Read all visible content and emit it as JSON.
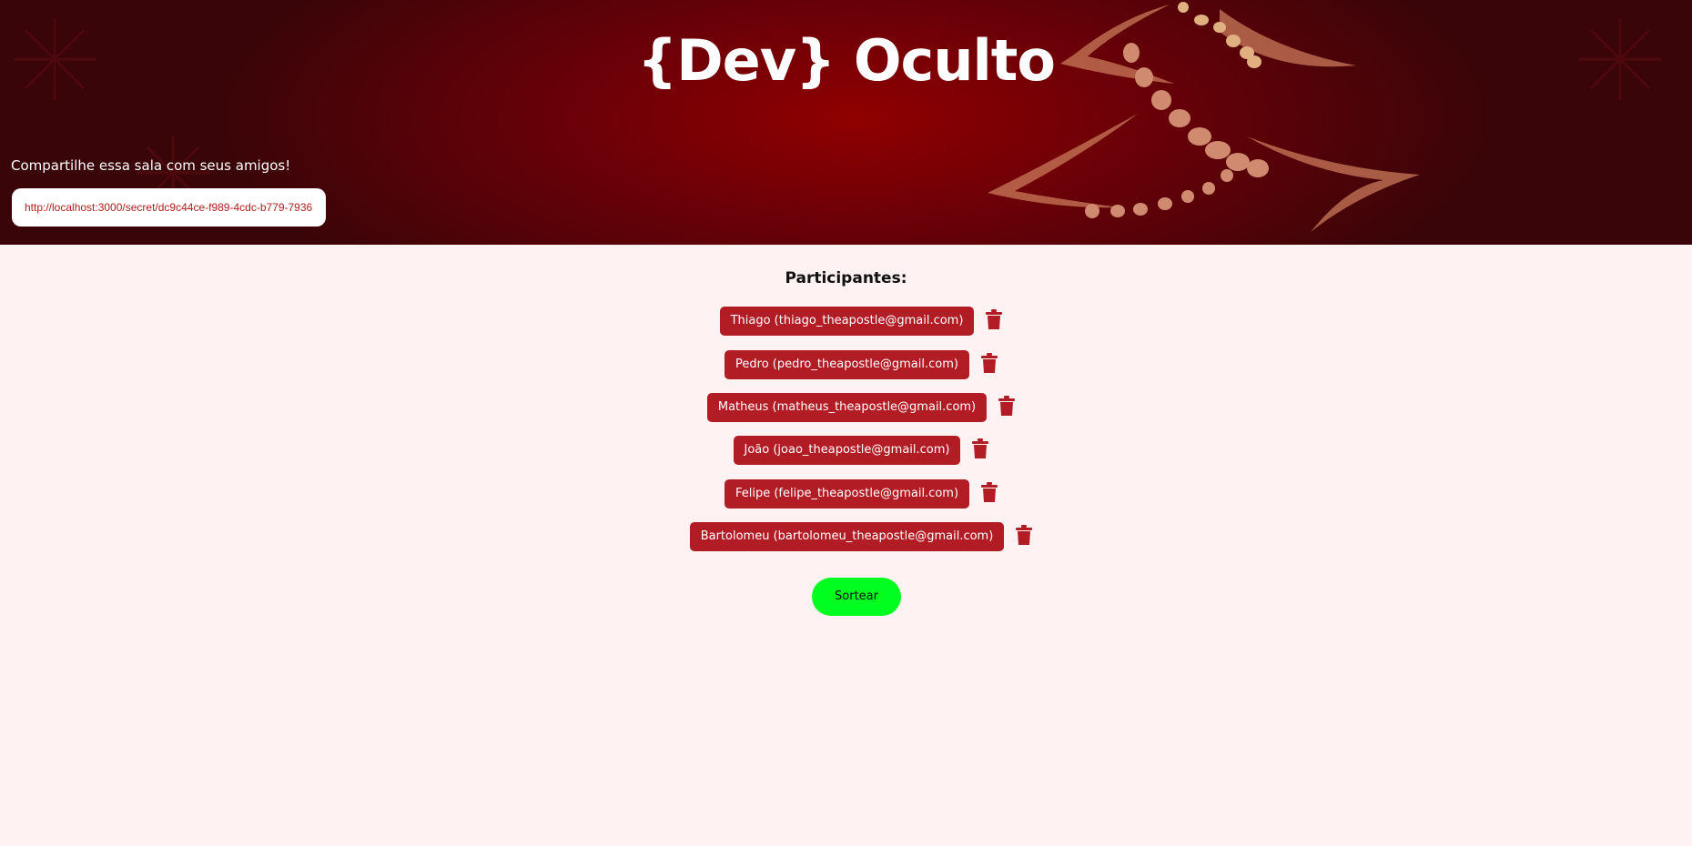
{
  "header": {
    "title": "{Dev} Oculto",
    "share_label": "Compartilhe essa sala com seus amigos!",
    "share_link": "http://localhost:3000/secret/dc9c44ce-f989-4cdc-b779-7936"
  },
  "participants": {
    "title": "Participantes:",
    "items": [
      {
        "label": "Thiago (thiago_theapostle@gmail.com)",
        "icon": "trash-icon"
      },
      {
        "label": "Pedro (pedro_theapostle@gmail.com)",
        "icon": "trash-icon"
      },
      {
        "label": "Matheus (matheus_theapostle@gmail.com)",
        "icon": "trash-icon"
      },
      {
        "label": "João (joao_theapostle@gmail.com)",
        "icon": "trash-icon"
      },
      {
        "label": "Felipe (felipe_theapostle@gmail.com)",
        "icon": "trash-icon"
      },
      {
        "label": "Bartolomeu (bartolomeu_theapostle@gmail.com)",
        "icon": "trash-icon"
      }
    ]
  },
  "actions": {
    "draw_label": "Sortear"
  },
  "colors": {
    "banner": "#8f0000",
    "pill": "#b21c24",
    "draw_button": "#00ff20",
    "background": "#fff2f2"
  }
}
